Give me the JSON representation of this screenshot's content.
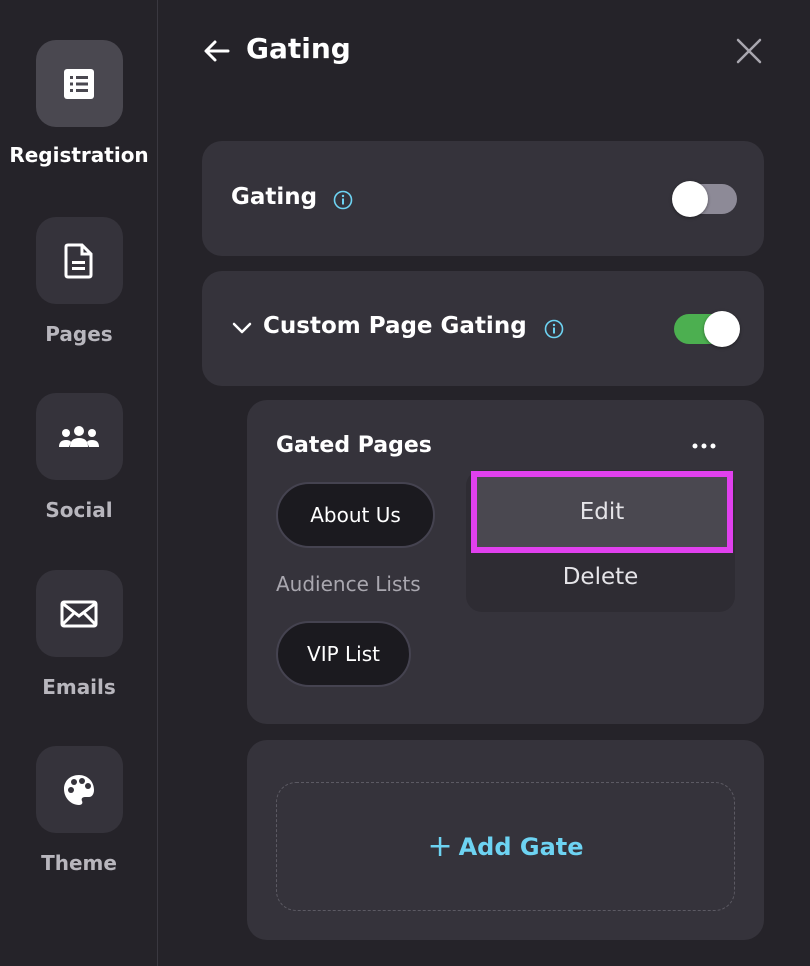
{
  "sidebar": {
    "items": [
      {
        "label": "Registration",
        "icon": "list-icon",
        "active": true
      },
      {
        "label": "Pages",
        "icon": "document-icon",
        "active": false
      },
      {
        "label": "Social",
        "icon": "people-icon",
        "active": false
      },
      {
        "label": "Emails",
        "icon": "envelope-icon",
        "active": false
      },
      {
        "label": "Theme",
        "icon": "palette-icon",
        "active": false
      }
    ]
  },
  "header": {
    "title": "Gating"
  },
  "gating": {
    "label": "Gating",
    "enabled": false
  },
  "custom_gating": {
    "label": "Custom Page Gating",
    "enabled": true
  },
  "gated_pages": {
    "title": "Gated Pages",
    "pages": [
      "About Us"
    ],
    "audience_heading": "Audience Lists",
    "audiences": [
      "VIP List"
    ]
  },
  "menu": {
    "edit_label": "Edit",
    "delete_label": "Delete"
  },
  "add_gate": {
    "label": "Add Gate"
  },
  "colors": {
    "background": "#252329",
    "card": "#35333b",
    "toggle_on": "#4caf50",
    "toggle_off": "#8d8a97",
    "accent": "#6dd3f2",
    "highlight": "#e040ee"
  }
}
